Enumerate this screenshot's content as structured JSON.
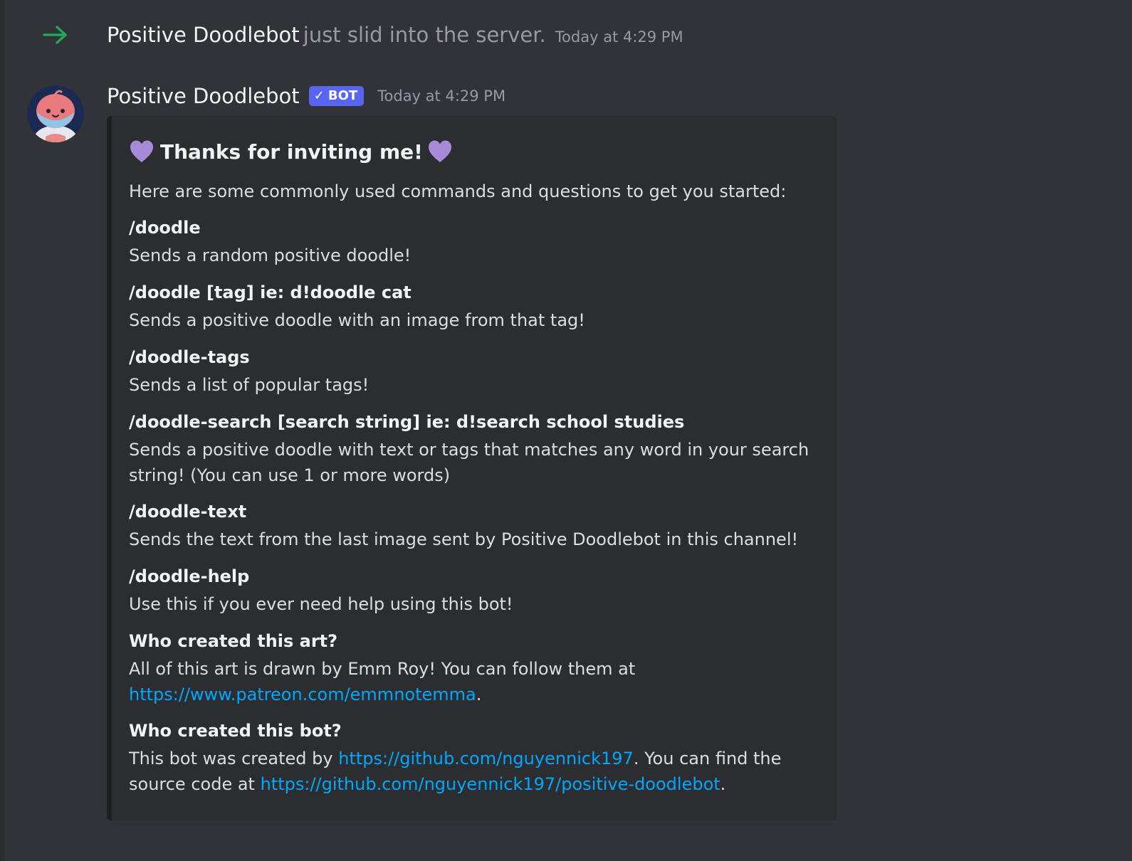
{
  "join": {
    "name": "Positive Doodlebot",
    "message": "just slid into the server.",
    "time": "Today at 4:29 PM"
  },
  "message": {
    "author": "Positive Doodlebot",
    "bot_tag": "BOT",
    "time": "Today at 4:29 PM"
  },
  "embed": {
    "title": "Thanks for inviting me!",
    "description": "Here are some commonly used commands and questions to get you started:",
    "fields": [
      {
        "name": "/doodle",
        "value": "Sends a random positive doodle!"
      },
      {
        "name": "/doodle [tag] ie: d!doodle cat",
        "value": "Sends a positive doodle with an image from that tag!"
      },
      {
        "name": "/doodle-tags",
        "value": "Sends a list of popular tags!"
      },
      {
        "name": "/doodle-search [search string] ie: d!search school studies",
        "value": "Sends a positive doodle with text or tags that matches any word in your search string! (You can use 1 or more words)"
      },
      {
        "name": "/doodle-text",
        "value": "Sends the text from the last image sent by Positive Doodlebot in this channel!"
      },
      {
        "name": "/doodle-help",
        "value": "Use this if you ever need help using this bot!"
      }
    ],
    "art_field": {
      "name": "Who created this art?",
      "value_prefix": "All of this art is drawn by Emm Roy! You can follow them at",
      "link": "https://www.patreon.com/emmnotemma",
      "value_suffix": "."
    },
    "bot_field": {
      "name": "Who created this bot?",
      "value_prefix": "This bot was created by",
      "link1": "https://github.com/nguyennick197",
      "value_middle": ". You can find the source code at",
      "link2": "https://github.com/nguyennick197/positive-doodlebot",
      "value_suffix": "."
    }
  },
  "colors": {
    "background": "#313338",
    "embed_background": "#2b2d31",
    "link": "#00a8fc",
    "bot_tag": "#5865f2",
    "join_arrow": "#23a55a",
    "heart": "#a78bd8"
  }
}
